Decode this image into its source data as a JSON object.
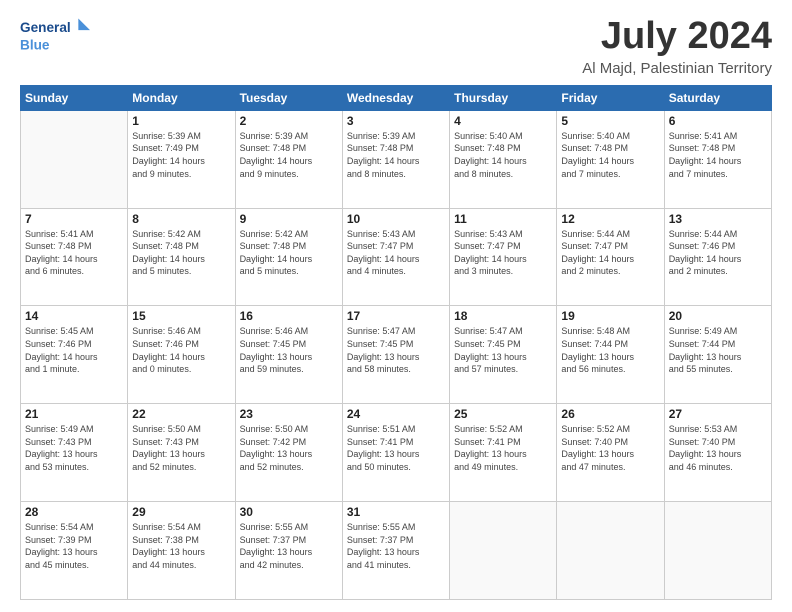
{
  "header": {
    "logo_line1": "General",
    "logo_line2": "Blue",
    "month_title": "July 2024",
    "location": "Al Majd, Palestinian Territory"
  },
  "weekdays": [
    "Sunday",
    "Monday",
    "Tuesday",
    "Wednesday",
    "Thursday",
    "Friday",
    "Saturday"
  ],
  "weeks": [
    [
      {
        "day": "",
        "info": ""
      },
      {
        "day": "1",
        "info": "Sunrise: 5:39 AM\nSunset: 7:49 PM\nDaylight: 14 hours\nand 9 minutes."
      },
      {
        "day": "2",
        "info": "Sunrise: 5:39 AM\nSunset: 7:48 PM\nDaylight: 14 hours\nand 9 minutes."
      },
      {
        "day": "3",
        "info": "Sunrise: 5:39 AM\nSunset: 7:48 PM\nDaylight: 14 hours\nand 8 minutes."
      },
      {
        "day": "4",
        "info": "Sunrise: 5:40 AM\nSunset: 7:48 PM\nDaylight: 14 hours\nand 8 minutes."
      },
      {
        "day": "5",
        "info": "Sunrise: 5:40 AM\nSunset: 7:48 PM\nDaylight: 14 hours\nand 7 minutes."
      },
      {
        "day": "6",
        "info": "Sunrise: 5:41 AM\nSunset: 7:48 PM\nDaylight: 14 hours\nand 7 minutes."
      }
    ],
    [
      {
        "day": "7",
        "info": "Sunrise: 5:41 AM\nSunset: 7:48 PM\nDaylight: 14 hours\nand 6 minutes."
      },
      {
        "day": "8",
        "info": "Sunrise: 5:42 AM\nSunset: 7:48 PM\nDaylight: 14 hours\nand 5 minutes."
      },
      {
        "day": "9",
        "info": "Sunrise: 5:42 AM\nSunset: 7:48 PM\nDaylight: 14 hours\nand 5 minutes."
      },
      {
        "day": "10",
        "info": "Sunrise: 5:43 AM\nSunset: 7:47 PM\nDaylight: 14 hours\nand 4 minutes."
      },
      {
        "day": "11",
        "info": "Sunrise: 5:43 AM\nSunset: 7:47 PM\nDaylight: 14 hours\nand 3 minutes."
      },
      {
        "day": "12",
        "info": "Sunrise: 5:44 AM\nSunset: 7:47 PM\nDaylight: 14 hours\nand 2 minutes."
      },
      {
        "day": "13",
        "info": "Sunrise: 5:44 AM\nSunset: 7:46 PM\nDaylight: 14 hours\nand 2 minutes."
      }
    ],
    [
      {
        "day": "14",
        "info": "Sunrise: 5:45 AM\nSunset: 7:46 PM\nDaylight: 14 hours\nand 1 minute."
      },
      {
        "day": "15",
        "info": "Sunrise: 5:46 AM\nSunset: 7:46 PM\nDaylight: 14 hours\nand 0 minutes."
      },
      {
        "day": "16",
        "info": "Sunrise: 5:46 AM\nSunset: 7:45 PM\nDaylight: 13 hours\nand 59 minutes."
      },
      {
        "day": "17",
        "info": "Sunrise: 5:47 AM\nSunset: 7:45 PM\nDaylight: 13 hours\nand 58 minutes."
      },
      {
        "day": "18",
        "info": "Sunrise: 5:47 AM\nSunset: 7:45 PM\nDaylight: 13 hours\nand 57 minutes."
      },
      {
        "day": "19",
        "info": "Sunrise: 5:48 AM\nSunset: 7:44 PM\nDaylight: 13 hours\nand 56 minutes."
      },
      {
        "day": "20",
        "info": "Sunrise: 5:49 AM\nSunset: 7:44 PM\nDaylight: 13 hours\nand 55 minutes."
      }
    ],
    [
      {
        "day": "21",
        "info": "Sunrise: 5:49 AM\nSunset: 7:43 PM\nDaylight: 13 hours\nand 53 minutes."
      },
      {
        "day": "22",
        "info": "Sunrise: 5:50 AM\nSunset: 7:43 PM\nDaylight: 13 hours\nand 52 minutes."
      },
      {
        "day": "23",
        "info": "Sunrise: 5:50 AM\nSunset: 7:42 PM\nDaylight: 13 hours\nand 52 minutes."
      },
      {
        "day": "24",
        "info": "Sunrise: 5:51 AM\nSunset: 7:41 PM\nDaylight: 13 hours\nand 50 minutes."
      },
      {
        "day": "25",
        "info": "Sunrise: 5:52 AM\nSunset: 7:41 PM\nDaylight: 13 hours\nand 49 minutes."
      },
      {
        "day": "26",
        "info": "Sunrise: 5:52 AM\nSunset: 7:40 PM\nDaylight: 13 hours\nand 47 minutes."
      },
      {
        "day": "27",
        "info": "Sunrise: 5:53 AM\nSunset: 7:40 PM\nDaylight: 13 hours\nand 46 minutes."
      }
    ],
    [
      {
        "day": "28",
        "info": "Sunrise: 5:54 AM\nSunset: 7:39 PM\nDaylight: 13 hours\nand 45 minutes."
      },
      {
        "day": "29",
        "info": "Sunrise: 5:54 AM\nSunset: 7:38 PM\nDaylight: 13 hours\nand 44 minutes."
      },
      {
        "day": "30",
        "info": "Sunrise: 5:55 AM\nSunset: 7:37 PM\nDaylight: 13 hours\nand 42 minutes."
      },
      {
        "day": "31",
        "info": "Sunrise: 5:55 AM\nSunset: 7:37 PM\nDaylight: 13 hours\nand 41 minutes."
      },
      {
        "day": "",
        "info": ""
      },
      {
        "day": "",
        "info": ""
      },
      {
        "day": "",
        "info": ""
      }
    ]
  ]
}
